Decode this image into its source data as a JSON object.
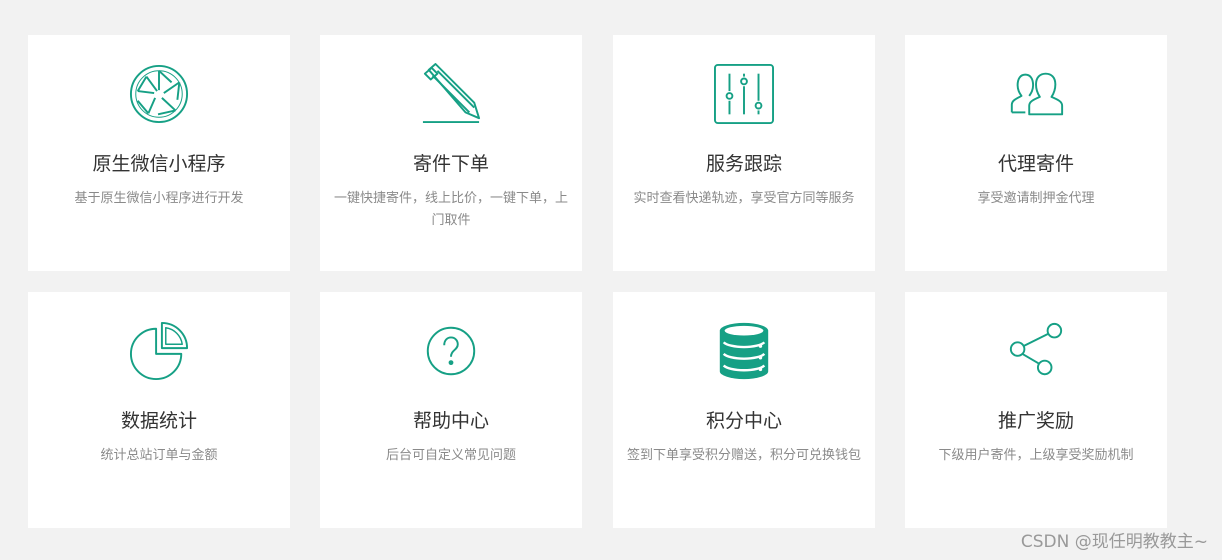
{
  "theme": {
    "accent": "#16a085",
    "background": "#f2f2f2",
    "card_background": "#ffffff",
    "title_color": "#333333",
    "desc_color": "#8a8a8a"
  },
  "cards": [
    {
      "icon": "camera-aperture-icon",
      "title": "原生微信小程序",
      "desc": "基于原生微信小程序进行开发"
    },
    {
      "icon": "pencil-icon",
      "title": "寄件下单",
      "desc": "一键快捷寄件，线上比价，一键下单，上门取件"
    },
    {
      "icon": "sliders-icon",
      "title": "服务跟踪",
      "desc": "实时查看快递轨迹，享受官方同等服务"
    },
    {
      "icon": "users-icon",
      "title": "代理寄件",
      "desc": "享受邀请制押金代理"
    },
    {
      "icon": "pie-chart-icon",
      "title": "数据统计",
      "desc": "统计总站订单与金额"
    },
    {
      "icon": "question-circle-icon",
      "title": "帮助中心",
      "desc": "后台可自定义常见问题"
    },
    {
      "icon": "database-icon",
      "title": "积分中心",
      "desc": "签到下单享受积分赠送，积分可兑换钱包"
    },
    {
      "icon": "share-icon",
      "title": "推广奖励",
      "desc": "下级用户寄件，上级享受奖励机制"
    }
  ],
  "watermark": "CSDN @现任明教教主~"
}
